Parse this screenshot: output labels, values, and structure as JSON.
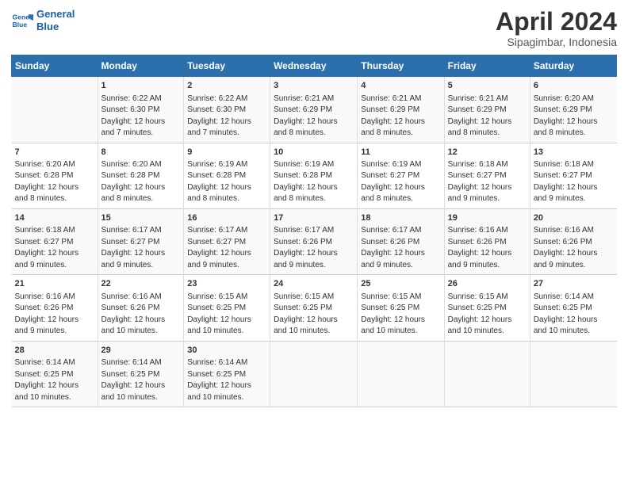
{
  "logo": {
    "line1": "General",
    "line2": "Blue"
  },
  "title": "April 2024",
  "subtitle": "Sipagimbar, Indonesia",
  "days": [
    "Sunday",
    "Monday",
    "Tuesday",
    "Wednesday",
    "Thursday",
    "Friday",
    "Saturday"
  ],
  "weeks": [
    [
      {
        "num": "",
        "lines": []
      },
      {
        "num": "1",
        "lines": [
          "Sunrise: 6:22 AM",
          "Sunset: 6:30 PM",
          "Daylight: 12 hours",
          "and 7 minutes."
        ]
      },
      {
        "num": "2",
        "lines": [
          "Sunrise: 6:22 AM",
          "Sunset: 6:30 PM",
          "Daylight: 12 hours",
          "and 7 minutes."
        ]
      },
      {
        "num": "3",
        "lines": [
          "Sunrise: 6:21 AM",
          "Sunset: 6:29 PM",
          "Daylight: 12 hours",
          "and 8 minutes."
        ]
      },
      {
        "num": "4",
        "lines": [
          "Sunrise: 6:21 AM",
          "Sunset: 6:29 PM",
          "Daylight: 12 hours",
          "and 8 minutes."
        ]
      },
      {
        "num": "5",
        "lines": [
          "Sunrise: 6:21 AM",
          "Sunset: 6:29 PM",
          "Daylight: 12 hours",
          "and 8 minutes."
        ]
      },
      {
        "num": "6",
        "lines": [
          "Sunrise: 6:20 AM",
          "Sunset: 6:29 PM",
          "Daylight: 12 hours",
          "and 8 minutes."
        ]
      }
    ],
    [
      {
        "num": "7",
        "lines": [
          "Sunrise: 6:20 AM",
          "Sunset: 6:28 PM",
          "Daylight: 12 hours",
          "and 8 minutes."
        ]
      },
      {
        "num": "8",
        "lines": [
          "Sunrise: 6:20 AM",
          "Sunset: 6:28 PM",
          "Daylight: 12 hours",
          "and 8 minutes."
        ]
      },
      {
        "num": "9",
        "lines": [
          "Sunrise: 6:19 AM",
          "Sunset: 6:28 PM",
          "Daylight: 12 hours",
          "and 8 minutes."
        ]
      },
      {
        "num": "10",
        "lines": [
          "Sunrise: 6:19 AM",
          "Sunset: 6:28 PM",
          "Daylight: 12 hours",
          "and 8 minutes."
        ]
      },
      {
        "num": "11",
        "lines": [
          "Sunrise: 6:19 AM",
          "Sunset: 6:27 PM",
          "Daylight: 12 hours",
          "and 8 minutes."
        ]
      },
      {
        "num": "12",
        "lines": [
          "Sunrise: 6:18 AM",
          "Sunset: 6:27 PM",
          "Daylight: 12 hours",
          "and 9 minutes."
        ]
      },
      {
        "num": "13",
        "lines": [
          "Sunrise: 6:18 AM",
          "Sunset: 6:27 PM",
          "Daylight: 12 hours",
          "and 9 minutes."
        ]
      }
    ],
    [
      {
        "num": "14",
        "lines": [
          "Sunrise: 6:18 AM",
          "Sunset: 6:27 PM",
          "Daylight: 12 hours",
          "and 9 minutes."
        ]
      },
      {
        "num": "15",
        "lines": [
          "Sunrise: 6:17 AM",
          "Sunset: 6:27 PM",
          "Daylight: 12 hours",
          "and 9 minutes."
        ]
      },
      {
        "num": "16",
        "lines": [
          "Sunrise: 6:17 AM",
          "Sunset: 6:27 PM",
          "Daylight: 12 hours",
          "and 9 minutes."
        ]
      },
      {
        "num": "17",
        "lines": [
          "Sunrise: 6:17 AM",
          "Sunset: 6:26 PM",
          "Daylight: 12 hours",
          "and 9 minutes."
        ]
      },
      {
        "num": "18",
        "lines": [
          "Sunrise: 6:17 AM",
          "Sunset: 6:26 PM",
          "Daylight: 12 hours",
          "and 9 minutes."
        ]
      },
      {
        "num": "19",
        "lines": [
          "Sunrise: 6:16 AM",
          "Sunset: 6:26 PM",
          "Daylight: 12 hours",
          "and 9 minutes."
        ]
      },
      {
        "num": "20",
        "lines": [
          "Sunrise: 6:16 AM",
          "Sunset: 6:26 PM",
          "Daylight: 12 hours",
          "and 9 minutes."
        ]
      }
    ],
    [
      {
        "num": "21",
        "lines": [
          "Sunrise: 6:16 AM",
          "Sunset: 6:26 PM",
          "Daylight: 12 hours",
          "and 9 minutes."
        ]
      },
      {
        "num": "22",
        "lines": [
          "Sunrise: 6:16 AM",
          "Sunset: 6:26 PM",
          "Daylight: 12 hours",
          "and 10 minutes."
        ]
      },
      {
        "num": "23",
        "lines": [
          "Sunrise: 6:15 AM",
          "Sunset: 6:25 PM",
          "Daylight: 12 hours",
          "and 10 minutes."
        ]
      },
      {
        "num": "24",
        "lines": [
          "Sunrise: 6:15 AM",
          "Sunset: 6:25 PM",
          "Daylight: 12 hours",
          "and 10 minutes."
        ]
      },
      {
        "num": "25",
        "lines": [
          "Sunrise: 6:15 AM",
          "Sunset: 6:25 PM",
          "Daylight: 12 hours",
          "and 10 minutes."
        ]
      },
      {
        "num": "26",
        "lines": [
          "Sunrise: 6:15 AM",
          "Sunset: 6:25 PM",
          "Daylight: 12 hours",
          "and 10 minutes."
        ]
      },
      {
        "num": "27",
        "lines": [
          "Sunrise: 6:14 AM",
          "Sunset: 6:25 PM",
          "Daylight: 12 hours",
          "and 10 minutes."
        ]
      }
    ],
    [
      {
        "num": "28",
        "lines": [
          "Sunrise: 6:14 AM",
          "Sunset: 6:25 PM",
          "Daylight: 12 hours",
          "and 10 minutes."
        ]
      },
      {
        "num": "29",
        "lines": [
          "Sunrise: 6:14 AM",
          "Sunset: 6:25 PM",
          "Daylight: 12 hours",
          "and 10 minutes."
        ]
      },
      {
        "num": "30",
        "lines": [
          "Sunrise: 6:14 AM",
          "Sunset: 6:25 PM",
          "Daylight: 12 hours",
          "and 10 minutes."
        ]
      },
      {
        "num": "",
        "lines": []
      },
      {
        "num": "",
        "lines": []
      },
      {
        "num": "",
        "lines": []
      },
      {
        "num": "",
        "lines": []
      }
    ]
  ]
}
